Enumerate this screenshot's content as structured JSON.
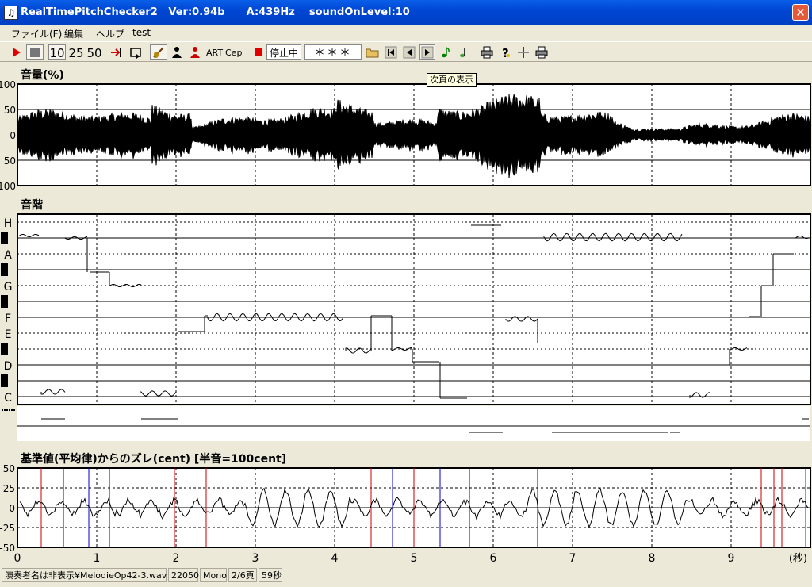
{
  "window": {
    "title": "RealTimePitchChecker2   Ver:0.94b      A:439Hz    soundOnLevel:10",
    "app_icon": "music-note-icon",
    "close": "close-icon"
  },
  "menu": [
    "ファイル(F)",
    "編集",
    "ヘルプ",
    "test"
  ],
  "toolbar": {
    "speeds": [
      "10",
      "25",
      "50"
    ],
    "art": "ART",
    "cep": "Cep",
    "status": "停止中",
    "stars": "＊＊＊",
    "icons": [
      "play-icon",
      "stop-icon",
      "jump-end-icon",
      "loop-icon",
      "violin-icon",
      "person-icon",
      "person-red-icon",
      "record-icon",
      "open-folder-icon",
      "first-page-icon",
      "prev-page-icon",
      "next-page-icon",
      "note-green-icon",
      "note-icon",
      "print-icon",
      "help-icon",
      "marker-icon",
      "print-icon"
    ]
  },
  "tooltip": "次頁の表示",
  "volume": {
    "label": "音量(%)",
    "ticks": [
      "100",
      "50",
      "0",
      "50",
      "100"
    ]
  },
  "scale": {
    "label": "音階",
    "notes": [
      "H",
      "A",
      "G",
      "F",
      "E",
      "D",
      "C"
    ]
  },
  "deviation": {
    "label": "基準値(平均律)からのズレ(cent) [半音=100cent]",
    "ticks": [
      "50",
      "25",
      "0",
      "-25",
      "-50"
    ]
  },
  "time_axis": {
    "ticks": [
      "0",
      "1",
      "2",
      "3",
      "4",
      "5",
      "6",
      "7",
      "8",
      "9"
    ],
    "unit": "(秒)"
  },
  "statusbar": {
    "file": "演奏者名は非表示¥MelodieOp42-3.wav",
    "rate": "22050",
    "channel": "Mono",
    "page": "2/6頁",
    "duration": "59秒"
  },
  "colors": {
    "titlebar": "#0a5fe8",
    "red_marker": "#cc0000",
    "blue_marker": "#0000cc"
  }
}
